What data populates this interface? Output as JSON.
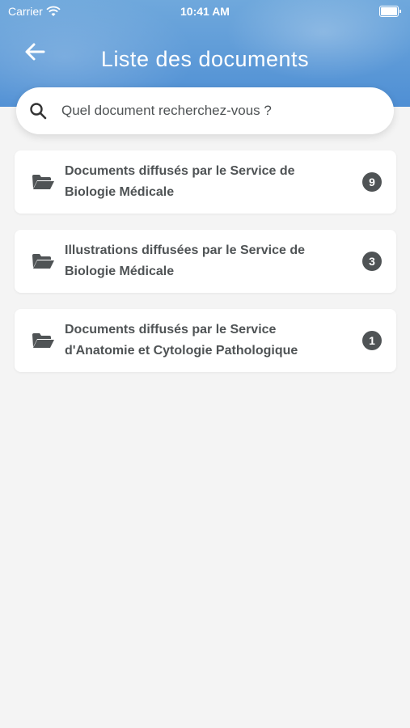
{
  "statusbar": {
    "carrier": "Carrier",
    "time": "10:41 AM"
  },
  "header": {
    "title": "Liste des documents",
    "back_icon": "arrow-left-icon"
  },
  "search": {
    "placeholder": "Quel document recherchez-vous ?",
    "value": "",
    "icon": "search-icon"
  },
  "folders": [
    {
      "line1": "Documents diffusés par le Service de",
      "line2": "Biologie Médicale",
      "count": "9"
    },
    {
      "line1": "Illustrations diffusées par le Service de",
      "line2": "Biologie Médicale",
      "count": "3"
    },
    {
      "line1": "Documents diffusés par le Service",
      "line2": "d'Anatomie et Cytologie Pathologique",
      "count": "1"
    }
  ],
  "colors": {
    "header": "#5a98d8",
    "text": "#4f5355",
    "background": "#f4f4f4"
  }
}
